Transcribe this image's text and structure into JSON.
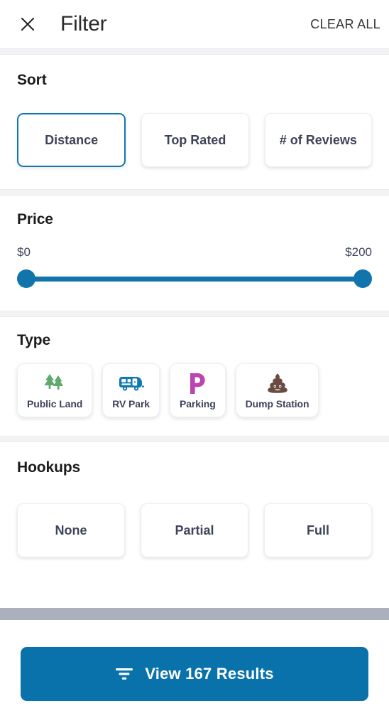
{
  "header": {
    "close_icon": "close-icon",
    "title": "Filter",
    "clear_all_label": "CLEAR ALL"
  },
  "sort": {
    "title": "Sort",
    "options": [
      {
        "label": "Distance",
        "selected": true
      },
      {
        "label": "Top Rated",
        "selected": false
      },
      {
        "label": "# of Reviews",
        "selected": false
      }
    ]
  },
  "price": {
    "title": "Price",
    "min_label": "$0",
    "max_label": "$200",
    "min_value": 0,
    "max_value": 200,
    "selected_min": 0,
    "selected_max": 200,
    "accent_color": "#1174ab"
  },
  "type": {
    "title": "Type",
    "options": [
      {
        "label": "Public Land",
        "icon": "pine-trees-icon",
        "icon_color": "#5fa96a"
      },
      {
        "label": "RV Park",
        "icon": "travel-trailer-icon",
        "icon_color": "#1278b2"
      },
      {
        "label": "Parking",
        "icon": "parking-p-icon",
        "icon_color": "#bb44b0"
      },
      {
        "label": "Dump Station",
        "icon": "dump-station-icon",
        "icon_color": "#6b4a3f"
      }
    ]
  },
  "hookups": {
    "title": "Hookups",
    "options": [
      {
        "label": "None",
        "selected": false
      },
      {
        "label": "Partial",
        "selected": false
      },
      {
        "label": "Full",
        "selected": false
      }
    ]
  },
  "footer": {
    "cta_icon": "filter-funnel-icon",
    "cta_label": "View 167 Results",
    "results_count": 167,
    "cta_color": "#0a72ab",
    "scrollbar_color": "#acafbc"
  }
}
